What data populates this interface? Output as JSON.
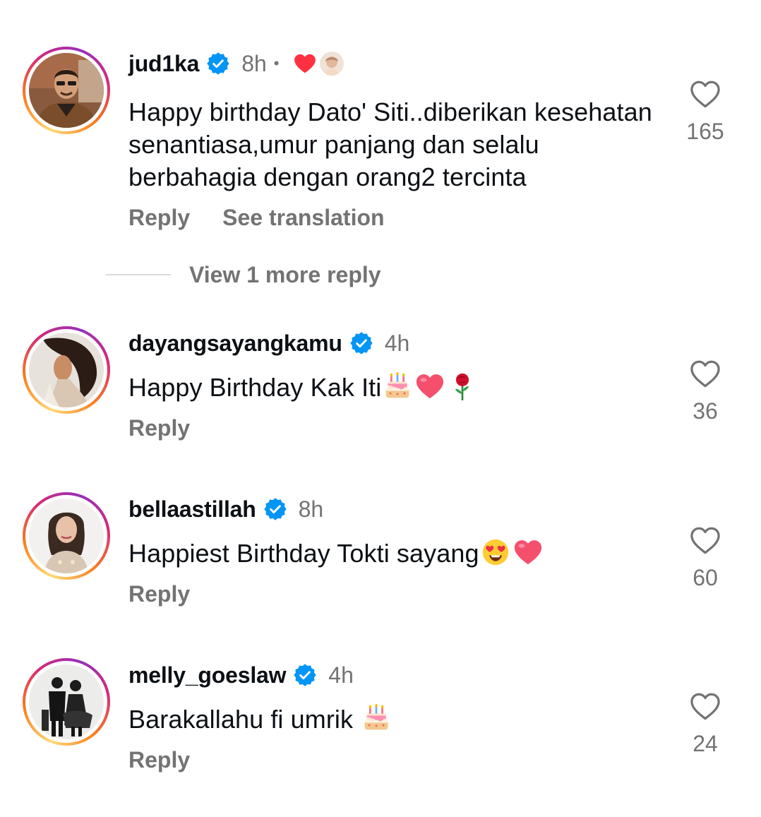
{
  "colors": {
    "text_primary": "#0c1014",
    "text_secondary": "#737373",
    "verified_blue": "#0095f6",
    "heart_red": "#ff3040"
  },
  "comments": [
    {
      "username": "jud1ka",
      "verified": true,
      "time": "8h",
      "time_separator": "•",
      "creator_liked": true,
      "text": "Happy birthday Dato' Siti..diberikan kesehatan senantiasa,umur panjang dan selalu berbahagia dengan orang2 tercinta",
      "emojis": [],
      "reply_label": "Reply",
      "translate_label": "See translation",
      "likes": "165",
      "avatar_icon": "man-in-jacket-avatar"
    },
    {
      "username": "dayangsayangkamu",
      "verified": true,
      "time": "4h",
      "text": "Happy Birthday Kak Iti",
      "emojis": [
        "birthday-cake-emoji",
        "pink-heart-emoji",
        "rose-emoji"
      ],
      "reply_label": "Reply",
      "likes": "36",
      "avatar_icon": "woman-profile-avatar"
    },
    {
      "username": "bellaastillah",
      "verified": true,
      "time": "8h",
      "text": "Happiest Birthday Tokti sayang",
      "emojis": [
        "heart-eyes-emoji",
        "pink-heart-emoji"
      ],
      "reply_label": "Reply",
      "likes": "60",
      "avatar_icon": "woman-portrait-avatar"
    },
    {
      "username": "melly_goeslaw",
      "verified": true,
      "time": "4h",
      "text": "Barakallahu fi umrik ",
      "emojis": [
        "birthday-cake-emoji"
      ],
      "reply_label": "Reply",
      "likes": "24",
      "avatar_icon": "couple-photo-avatar"
    }
  ],
  "view_more_replies": "View 1 more reply"
}
